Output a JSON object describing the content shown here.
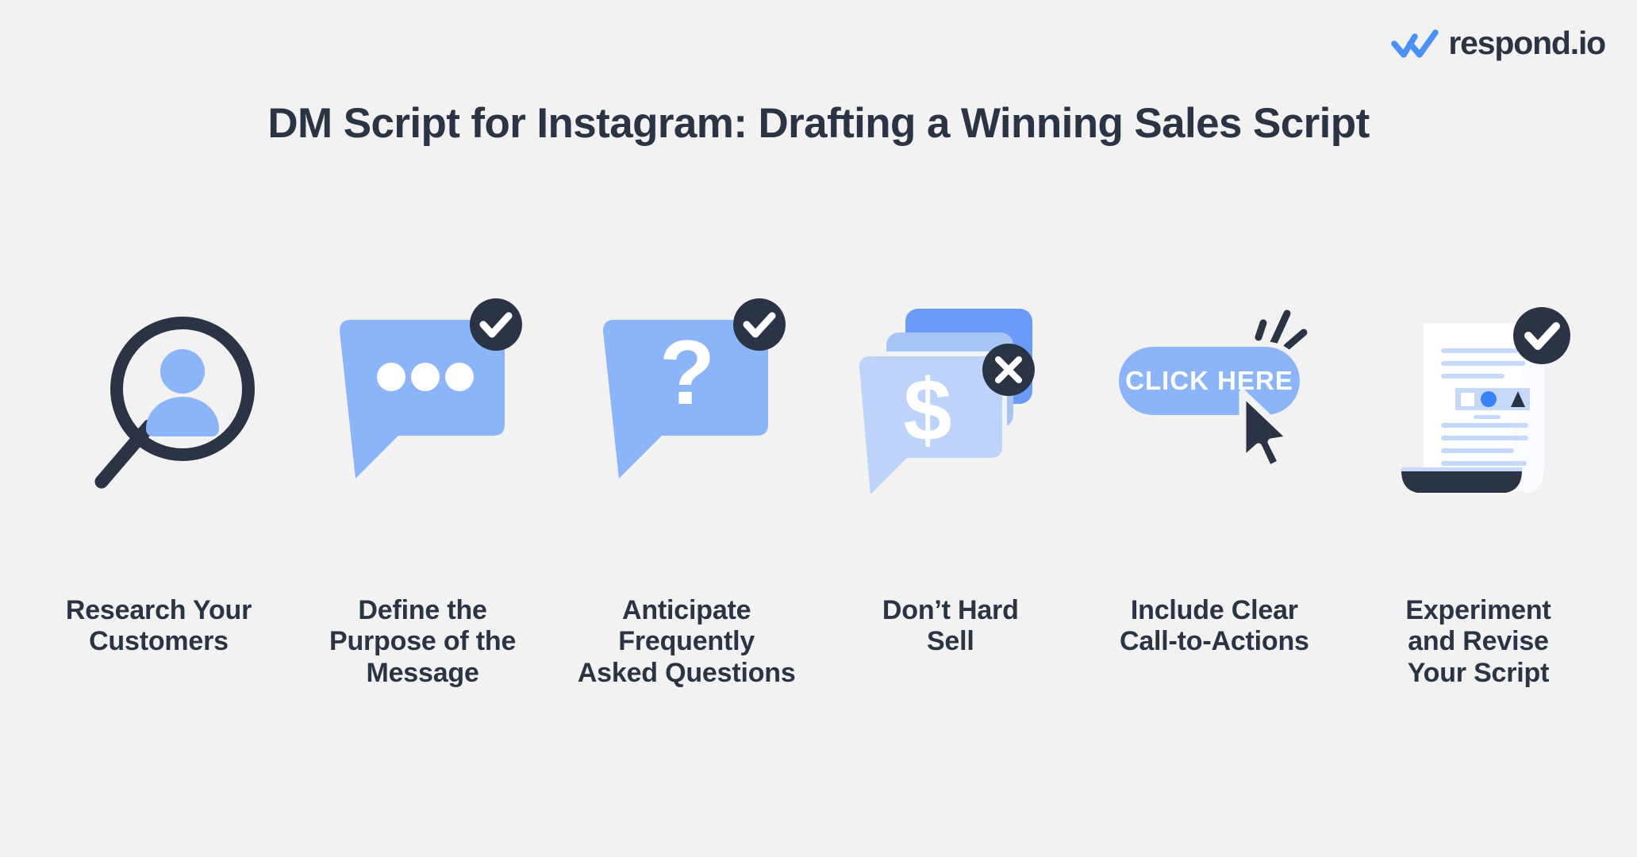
{
  "brand": {
    "logo_text": "respond.io",
    "logo_icon": "double-check-icon",
    "accent_blue": "#4A90F7",
    "dark_navy": "#2B3445",
    "background": "#F2F2F2"
  },
  "header": {
    "title": "DM Script for Instagram: Drafting a Winning Sales Script"
  },
  "steps": [
    {
      "id": "research-customers",
      "label": "Research Your\nCustomers",
      "icon": "magnifier-person-icon",
      "badge": null
    },
    {
      "id": "define-purpose",
      "label": "Define the\nPurpose of the\nMessage",
      "icon": "chat-bubble-ellipsis-icon",
      "badge": "check-badge-icon"
    },
    {
      "id": "anticipate-faq",
      "label": "Anticipate\nFrequently\nAsked Questions",
      "icon": "chat-bubble-question-icon",
      "badge": "check-badge-icon"
    },
    {
      "id": "dont-hard-sell",
      "label": "Don’t Hard\nSell",
      "icon": "stacked-bubbles-dollar-icon",
      "badge": "x-badge-icon"
    },
    {
      "id": "clear-ctas",
      "label": "Include Clear\nCall-to-Actions",
      "icon": "click-here-button-cursor-icon",
      "badge": null,
      "button_text": "CLICK HERE"
    },
    {
      "id": "experiment-revise",
      "label": "Experiment\nand Revise\nYour Script",
      "icon": "document-scroll-icon",
      "badge": "check-badge-icon"
    }
  ],
  "palette": {
    "bubble_blue": "#8CB4F8",
    "bubble_blue_dark": "#6B9BF7",
    "bubble_blue_mid": "#A8C4F5",
    "bubble_blue_light": "#BDD3F9",
    "doc_line_blue": "#C7D9FB",
    "circle_blue": "#3B82F6",
    "white": "#FFFFFF"
  }
}
